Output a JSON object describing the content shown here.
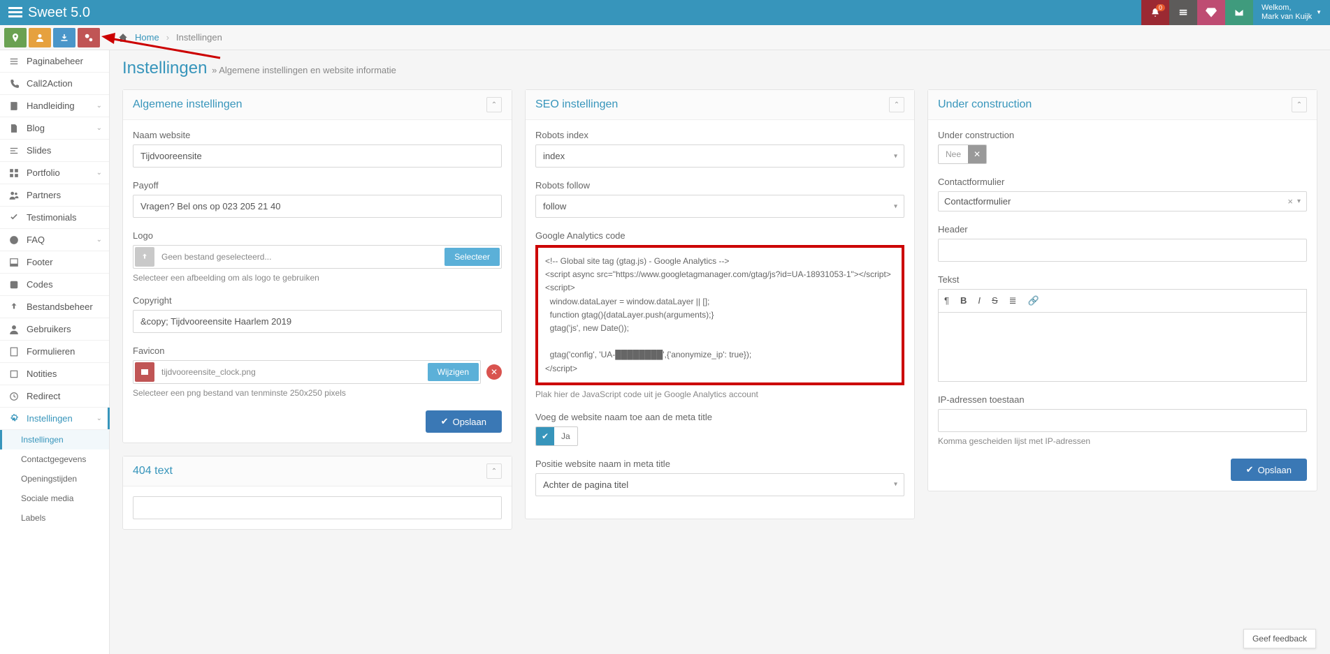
{
  "app": {
    "title": "Sweet 5.0"
  },
  "header": {
    "notif_count": "0",
    "welcome_label": "Welkom,",
    "user_name": "Mark van Kuijk"
  },
  "breadcrumb": {
    "home": "Home",
    "current": "Instellingen"
  },
  "page": {
    "title": "Instellingen",
    "subtitle": "» Algemene instellingen en website informatie"
  },
  "sidebar": {
    "items": [
      {
        "label": "Paginabeheer"
      },
      {
        "label": "Call2Action"
      },
      {
        "label": "Handleiding"
      },
      {
        "label": "Blog"
      },
      {
        "label": "Slides"
      },
      {
        "label": "Portfolio"
      },
      {
        "label": "Partners"
      },
      {
        "label": "Testimonials"
      },
      {
        "label": "FAQ"
      },
      {
        "label": "Footer"
      },
      {
        "label": "Codes"
      },
      {
        "label": "Bestandsbeheer"
      },
      {
        "label": "Gebruikers"
      },
      {
        "label": "Formulieren"
      },
      {
        "label": "Notities"
      },
      {
        "label": "Redirect"
      },
      {
        "label": "Instellingen"
      }
    ],
    "subs": [
      {
        "label": "Instellingen"
      },
      {
        "label": "Contactgegevens"
      },
      {
        "label": "Openingstijden"
      },
      {
        "label": "Sociale media"
      },
      {
        "label": "Labels"
      }
    ]
  },
  "panel1": {
    "title": "Algemene instellingen",
    "name_label": "Naam website",
    "name_value": "Tijdvooreensite",
    "payoff_label": "Payoff",
    "payoff_value": "Vragen? Bel ons op 023 205 21 40",
    "logo_label": "Logo",
    "logo_text": "Geen bestand geselecteerd...",
    "logo_btn": "Selecteer",
    "logo_help": "Selecteer een afbeelding om als logo te gebruiken",
    "copyright_label": "Copyright",
    "copyright_value": "&copy; Tijdvooreensite Haarlem 2019",
    "favicon_label": "Favicon",
    "favicon_text": "tijdvooreensite_clock.png",
    "favicon_btn": "Wijzigen",
    "favicon_help": "Selecteer een png bestand van tenminste 250x250 pixels",
    "save": "Opslaan"
  },
  "panel404": {
    "title": "404 text"
  },
  "panel2": {
    "title": "SEO instellingen",
    "robots_index_label": "Robots index",
    "robots_index_value": "index",
    "robots_follow_label": "Robots follow",
    "robots_follow_value": "follow",
    "ga_label": "Google Analytics code",
    "ga_code": "<!-- Global site tag (gtag.js) - Google Analytics -->\n<script async src=\"https://www.googletagmanager.com/gtag/js?id=UA-18931053-1\"></script>\n<script>\n  window.dataLayer = window.dataLayer || [];\n  function gtag(){dataLayer.push(arguments);}\n  gtag('js', new Date());\n\n  gtag('config', 'UA-████████',{'anonymize_ip': true});\n</script>",
    "ga_help": "Plak hier de JavaScript code uit je Google Analytics account",
    "meta_add_label": "Voeg de website naam toe aan de meta title",
    "meta_add_value": "Ja",
    "meta_pos_label": "Positie website naam in meta title",
    "meta_pos_value": "Achter de pagina titel"
  },
  "panel3": {
    "title": "Under construction",
    "uc_label": "Under construction",
    "uc_value": "Nee",
    "contact_label": "Contactformulier",
    "contact_value": "Contactformulier",
    "header_label": "Header",
    "text_label": "Tekst",
    "ip_label": "IP-adressen toestaan",
    "ip_help": "Komma gescheiden lijst met IP-adressen",
    "save": "Opslaan"
  },
  "feedback": "Geef feedback"
}
